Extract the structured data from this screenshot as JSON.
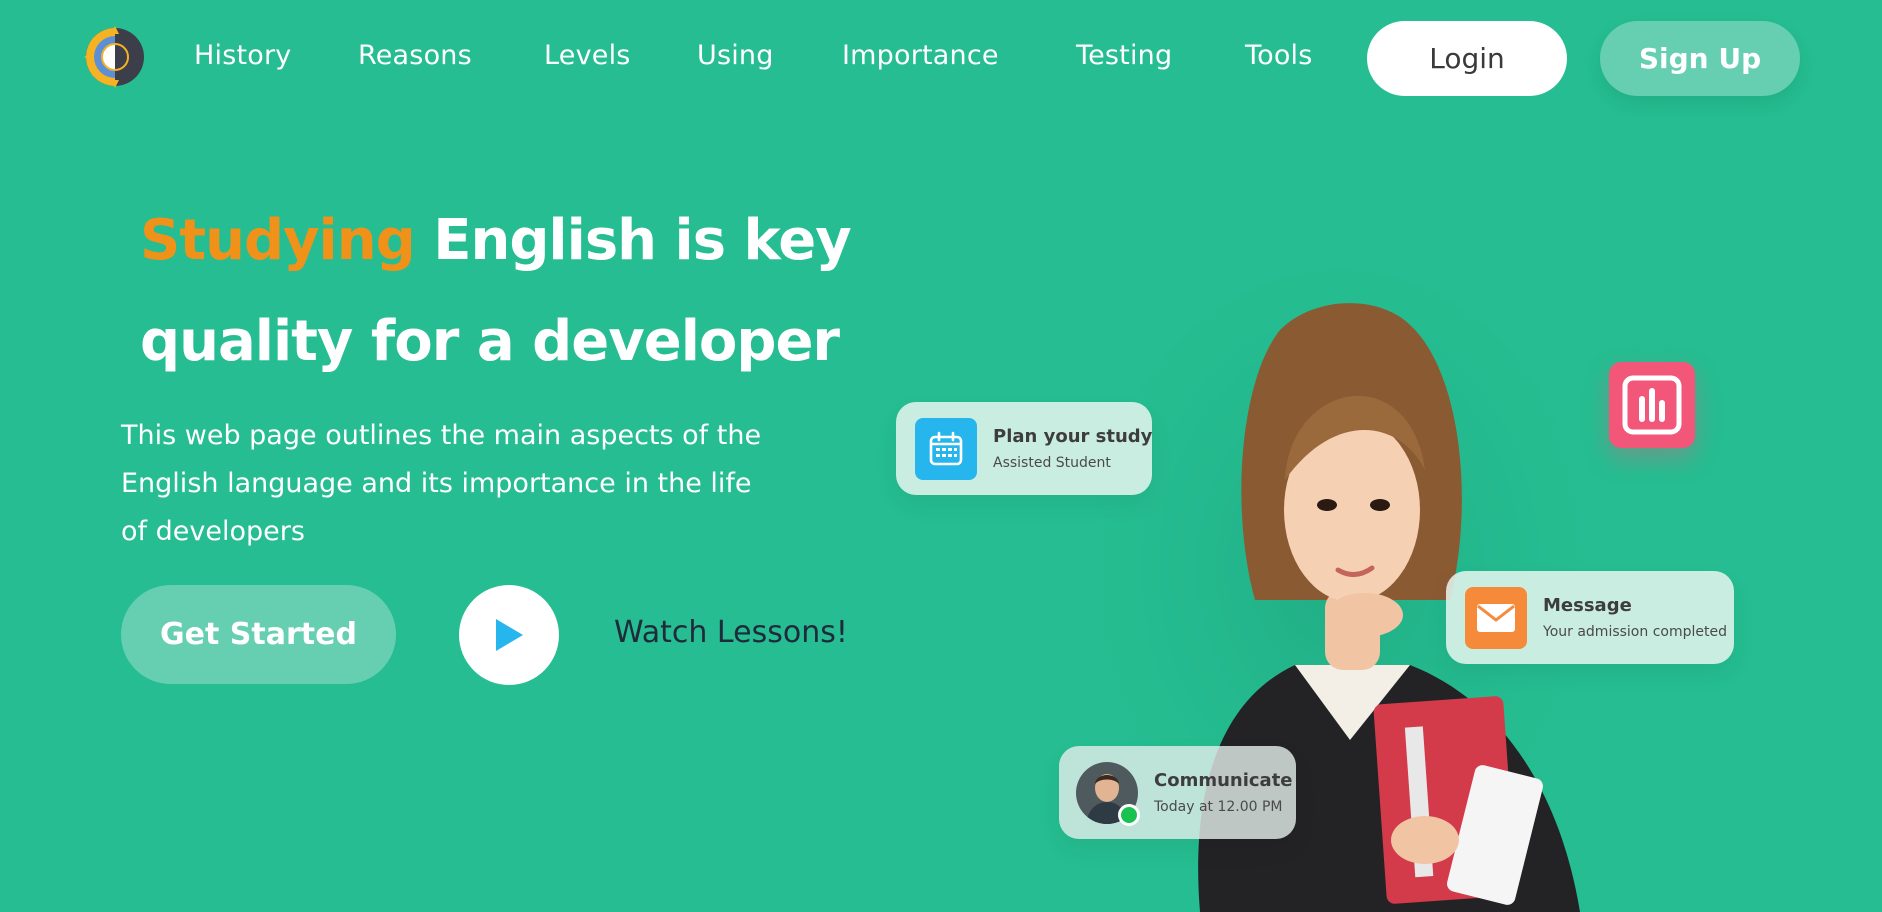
{
  "nav": {
    "items": [
      {
        "label": "History"
      },
      {
        "label": "Reasons"
      },
      {
        "label": "Levels"
      },
      {
        "label": "Using"
      },
      {
        "label": "Importance"
      },
      {
        "label": "Testing"
      },
      {
        "label": "Tools"
      }
    ],
    "login_label": "Login",
    "signup_label": "Sign Up"
  },
  "hero": {
    "headline_accent": "Studying",
    "headline_rest": " English is key quality for a developer",
    "subtitle": "This web page outlines the main aspects of the English language and its importance in the life of developers",
    "cta_label": "Get Started",
    "watch_label": "Watch Lessons!"
  },
  "cards": {
    "plan": {
      "title": "Plan your study",
      "subtitle": "Assisted Student",
      "icon": "calendar-icon"
    },
    "message": {
      "title": "Message",
      "subtitle": "Your admission completed",
      "icon": "envelope-icon"
    },
    "communicate": {
      "title": "Communicate",
      "subtitle": "Today at 12.00 PM",
      "icon": "avatar"
    }
  },
  "colors": {
    "background": "#25bd91",
    "accent_orange": "#f0911a",
    "button_light": "#66cfb2",
    "calendar_blue": "#27b5ee",
    "message_orange": "#f58b3a",
    "stats_pink": "#f2577a",
    "online_green": "#17c24f"
  }
}
